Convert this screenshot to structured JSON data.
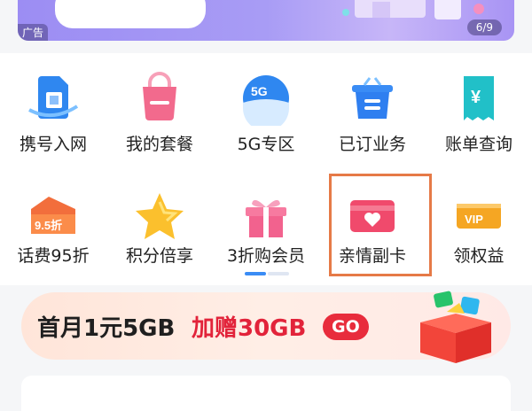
{
  "banner": {
    "ad_tag": "广告",
    "page_indicator": "6/9"
  },
  "grid": {
    "items": [
      {
        "label": "携号入网",
        "icon": "sim-card-icon"
      },
      {
        "label": "我的套餐",
        "icon": "bag-icon"
      },
      {
        "label": "5G专区",
        "icon": "5g-globe-icon"
      },
      {
        "label": "已订业务",
        "icon": "basket-icon"
      },
      {
        "label": "账单查询",
        "icon": "bill-icon"
      },
      {
        "label": "话费95折",
        "icon": "discount-tag-icon",
        "badge": "9.5折"
      },
      {
        "label": "积分倍享",
        "icon": "star-icon"
      },
      {
        "label": "3折购会员",
        "icon": "gift-icon"
      },
      {
        "label": "亲情副卡",
        "icon": "heart-card-icon"
      },
      {
        "label": "领权益",
        "icon": "vip-icon",
        "badge": "VIP"
      }
    ],
    "pager": {
      "active_index": 0,
      "total": 2
    }
  },
  "promo": {
    "text_main": "首月1元5GB",
    "text_highlight": "加赠30GB",
    "go_label": "GO"
  },
  "colors": {
    "accent_blue": "#3a8cf5",
    "highlight": "#e67a47",
    "promo_red": "#e2233a",
    "banner_purple": "#9c8df3"
  }
}
